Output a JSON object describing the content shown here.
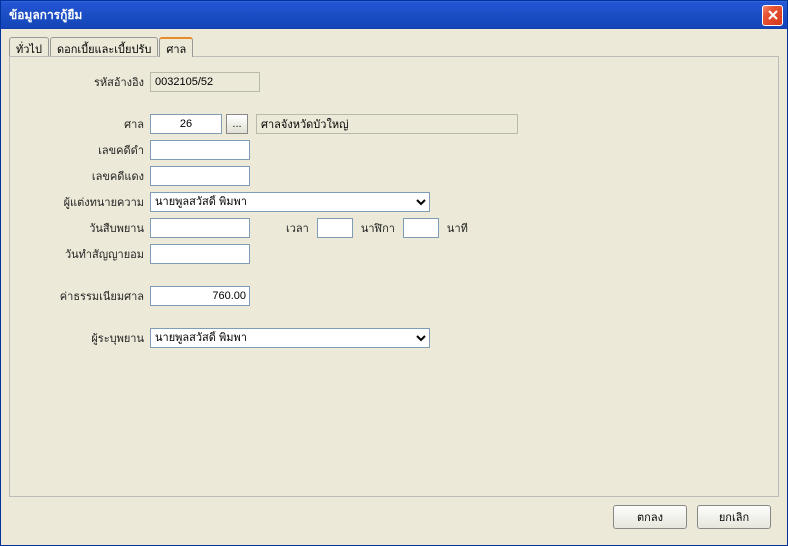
{
  "window": {
    "title": "ข้อมูลการกู้ยืม"
  },
  "tabs": {
    "general": "ทั่วไป",
    "interest_fine": "ดอกเบี้ยและเบี้ยปรับ",
    "court": "ศาล"
  },
  "labels": {
    "ref_code": "รหัสอ้างอิง",
    "court": "ศาล",
    "black_case": "เลขคดีดำ",
    "red_case": "เลขคดีแดง",
    "attorney": "ผู้แต่งทนายความ",
    "witness_date": "วันสืบพยาน",
    "time": "เวลา",
    "hours": "นาฬิกา",
    "minutes": "นาที",
    "contract_date": "วันทำสัญญายอม",
    "court_fee": "ค่าธรรมเนียมศาล",
    "witness_specifier": "ผู้ระบุพยาน"
  },
  "values": {
    "ref_code": "0032105/52",
    "court_code": "26",
    "court_name": "ศาลจังหวัดบัวใหญ่",
    "black_case": "",
    "red_case": "",
    "attorney": "นายพูลสวัสดิ์ พิมพา",
    "witness_date": "",
    "time_h": "",
    "time_m": "",
    "contract_date": "",
    "court_fee": "760.00",
    "witness_specifier": "นายพูลสวัสดิ์ พิมพา"
  },
  "buttons": {
    "ellipsis": "...",
    "ok": "ตกลง",
    "cancel": "ยกเลิก"
  }
}
